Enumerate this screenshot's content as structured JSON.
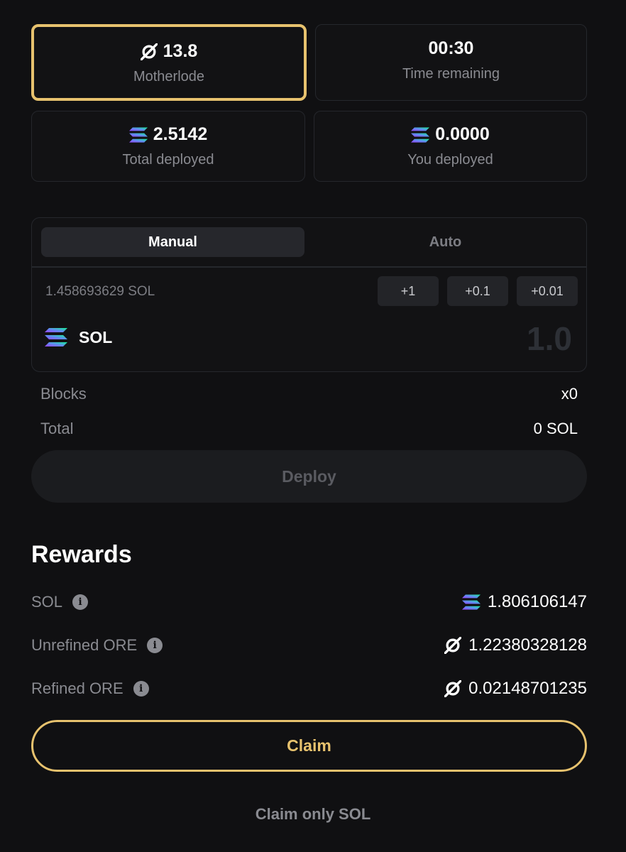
{
  "stats": {
    "motherlode": {
      "value": "13.8",
      "label": "Motherlode",
      "icon": "ore-icon"
    },
    "time": {
      "value": "00:30",
      "label": "Time remaining"
    },
    "total_deployed": {
      "value": "2.5142",
      "label": "Total deployed",
      "icon": "solana-icon"
    },
    "you_deployed": {
      "value": "0.0000",
      "label": "You deployed",
      "icon": "solana-icon"
    }
  },
  "deploy": {
    "tabs": [
      {
        "label": "Manual",
        "active": true
      },
      {
        "label": "Auto",
        "active": false
      }
    ],
    "balance": "1.458693629 SOL",
    "increments": [
      "+1",
      "+0.1",
      "+0.01"
    ],
    "token": "SOL",
    "amount_placeholder": "1.0"
  },
  "summary": {
    "blocks_label": "Blocks",
    "blocks_value": "x0",
    "total_label": "Total",
    "total_value": "0 SOL"
  },
  "deploy_button": "Deploy",
  "rewards": {
    "title": "Rewards",
    "rows": [
      {
        "label": "SOL",
        "value": "1.806106147",
        "icon": "solana-icon"
      },
      {
        "label": "Unrefined ORE",
        "value": "1.22380328128",
        "icon": "ore-icon"
      },
      {
        "label": "Refined ORE",
        "value": "0.02148701235",
        "icon": "ore-icon"
      }
    ]
  },
  "claim_button": "Claim",
  "claim_only_sol": "Claim only SOL",
  "colors": {
    "accent": "#e7c26e",
    "background": "#101012",
    "card": "#121214",
    "border": "#25272c"
  }
}
